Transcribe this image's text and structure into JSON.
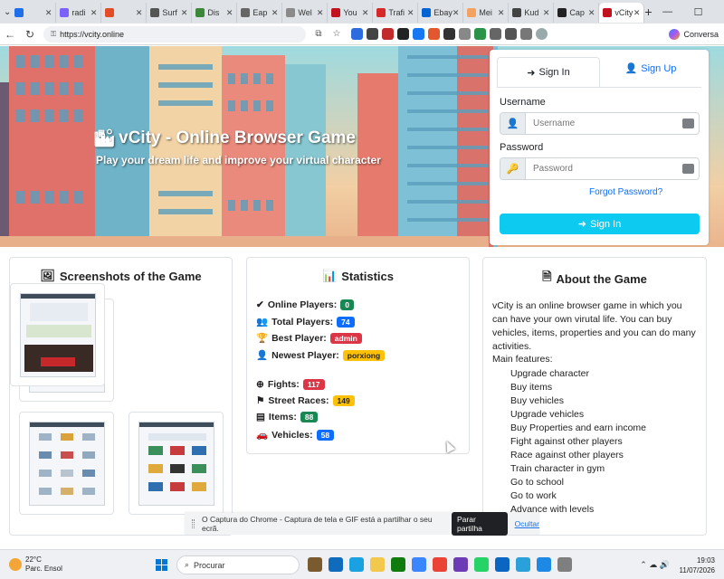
{
  "browser": {
    "tabs": [
      {
        "label": "",
        "color": "#1f6feb"
      },
      {
        "label": "radi",
        "color": "#7b61ff"
      },
      {
        "label": "",
        "color": "#e34c26"
      },
      {
        "label": "Surf",
        "color": "#555"
      },
      {
        "label": "Dis",
        "color": "#3c873a"
      },
      {
        "label": "Eap",
        "color": "#666"
      },
      {
        "label": "Wel",
        "color": "#8a8a8a"
      },
      {
        "label": "You",
        "color": "#c1121f"
      },
      {
        "label": "Trafi",
        "color": "#d62828"
      },
      {
        "label": "Ebay",
        "color": "#0064d2"
      },
      {
        "label": "Mei",
        "color": "#f4a261"
      },
      {
        "label": "Kud",
        "color": "#444"
      },
      {
        "label": "Cap",
        "color": "#222"
      },
      {
        "label": "vCity",
        "color": "#c1121f"
      }
    ],
    "url": "https://vcity.online",
    "copilot_label": "Conversa"
  },
  "hero": {
    "title": "vCity - Online Browser Game",
    "subtitle": "Play your dream life and improve your virtual character"
  },
  "login": {
    "tab_signin": "Sign In",
    "tab_signup": "Sign Up",
    "username_label": "Username",
    "username_placeholder": "Username",
    "password_label": "Password",
    "password_placeholder": "Password",
    "forgot": "Forgot Password?",
    "submit": "Sign In"
  },
  "screenshots": {
    "title": "Screenshots of the Game"
  },
  "statistics": {
    "title": "Statistics",
    "online_label": "Online Players:",
    "online_value": "0",
    "total_label": "Total Players:",
    "total_value": "74",
    "best_label": "Best Player:",
    "best_value": "admin",
    "newest_label": "Newest Player:",
    "newest_value": "porxiong",
    "fights_label": "Fights:",
    "fights_value": "117",
    "races_label": "Street Races:",
    "races_value": "149",
    "items_label": "Items:",
    "items_value": "88",
    "vehicles_label": "Vehicles:",
    "vehicles_value": "58"
  },
  "about": {
    "title": "About the Game",
    "text": "vCity is an online browser game in which you can have your own virutal life. You can buy vehicles, items, properties and you can do many activities.",
    "features_heading": "Main features:",
    "features": [
      "Upgrade character",
      "Buy items",
      "Buy vehicles",
      "Upgrade vehicles",
      "Buy Properties and earn income",
      "Fight against other players",
      "Race against other players",
      "Train character in gym",
      "Go to school",
      "Go to work",
      "Advance with levels"
    ]
  },
  "notification": {
    "text": "O Captura do Chrome - Captura de tela e GIF está a partilhar o seu ecrã.",
    "stop": "Parar partilha",
    "hide": "Ocultar"
  },
  "taskbar": {
    "temp": "22°C",
    "weather": "Parc. Ensol",
    "search": "Procurar",
    "time": "19:03",
    "date": "11/07/2026",
    "app_colors": [
      "#7a5a2f",
      "#0f6cbd",
      "#1aa1e2",
      "#f2c94c",
      "#107c10",
      "#3a86ff",
      "#ea4335",
      "#6c3bb5",
      "#25d366",
      "#0a66c2",
      "#2aa1da",
      "#1e88e5",
      "#7f7f7f"
    ]
  }
}
